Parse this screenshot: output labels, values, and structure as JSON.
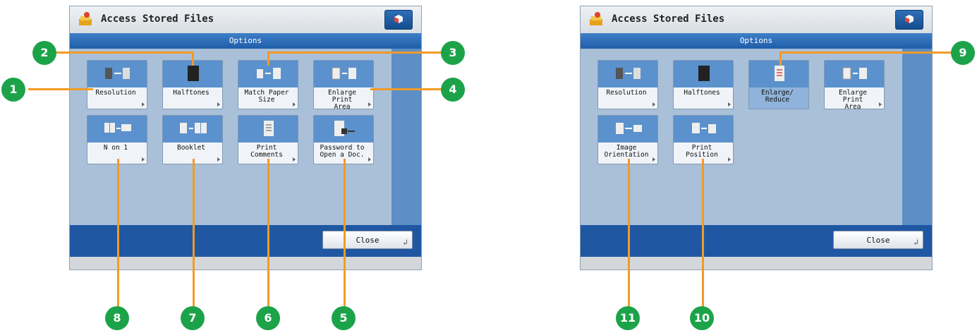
{
  "screens": [
    {
      "title": "Access Stored Files",
      "bar": "Options",
      "close_label": "Close",
      "tiles": [
        {
          "label": "Resolution"
        },
        {
          "label": "Halftones"
        },
        {
          "label": "Match Paper\nSize"
        },
        {
          "label": "Enlarge Print\nArea"
        },
        {
          "label": "N on 1"
        },
        {
          "label": "Booklet"
        },
        {
          "label": "Print\nComments"
        },
        {
          "label": "Password to\nOpen a Doc."
        }
      ]
    },
    {
      "title": "Access Stored Files",
      "bar": "Options",
      "close_label": "Close",
      "tiles": [
        {
          "label": "Resolution"
        },
        {
          "label": "Halftones"
        },
        {
          "label": "Enlarge/\nReduce"
        },
        {
          "label": "Enlarge Print\nArea"
        },
        {
          "label": "Image\nOrientation"
        },
        {
          "label": "Print Position"
        }
      ]
    }
  ],
  "callouts": [
    "1",
    "2",
    "3",
    "4",
    "5",
    "6",
    "7",
    "8",
    "9",
    "10",
    "11"
  ],
  "colors": {
    "callout": "#1ca34a",
    "leader": "#f39a26",
    "accent": "#1f57a3"
  }
}
